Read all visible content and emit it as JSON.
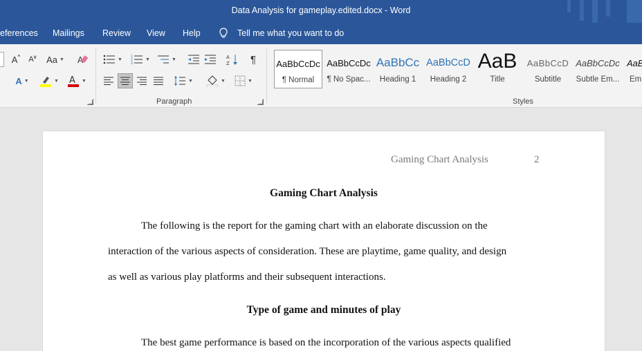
{
  "window": {
    "title": "Data Analysis for gameplay.edited.docx  -  Word"
  },
  "tabs": [
    "eferences",
    "Mailings",
    "Review",
    "View",
    "Help"
  ],
  "tell_me": "Tell me what you want to do",
  "groups": {
    "paragraph": "Paragraph",
    "styles": "Styles"
  },
  "font_group": {
    "grow_label": "A",
    "shrink_label": "A",
    "case_label": "Aa",
    "effects_label": "A",
    "color_label": "A"
  },
  "styles": [
    {
      "preview": "AaBbCcDc",
      "name": "¶ Normal",
      "selected": true
    },
    {
      "preview": "AaBbCcDc",
      "name": "¶ No Spac..."
    },
    {
      "preview": "AaBbCc",
      "name": "Heading 1"
    },
    {
      "preview": "AaBbCcD",
      "name": "Heading 2"
    },
    {
      "preview": "AaB",
      "name": "Title"
    },
    {
      "preview": "AaBbCcD",
      "name": "Subtitle"
    },
    {
      "preview": "AaBbCcDc",
      "name": "Subtle Em..."
    },
    {
      "preview": "AaBl",
      "name": "Em"
    }
  ],
  "colors": {
    "titlebar": "#2b579a",
    "highlight": "#ffff00",
    "font_color": "#d00000",
    "heading": "#2e74b5"
  },
  "document": {
    "running_head": "Gaming Chart Analysis",
    "page_number": "2",
    "title": "Gaming Chart Analysis",
    "paragraph1": [
      "The following is the report for the gaming chart with an elaborate discussion on the",
      "interaction of the various aspects of consideration. These are playtime, game quality, and design",
      "as well as various play platforms and their subsequent interactions."
    ],
    "heading2": "Type of game and minutes of play",
    "paragraph2": [
      "The best game performance is based on the incorporation of the various aspects qualified"
    ]
  }
}
